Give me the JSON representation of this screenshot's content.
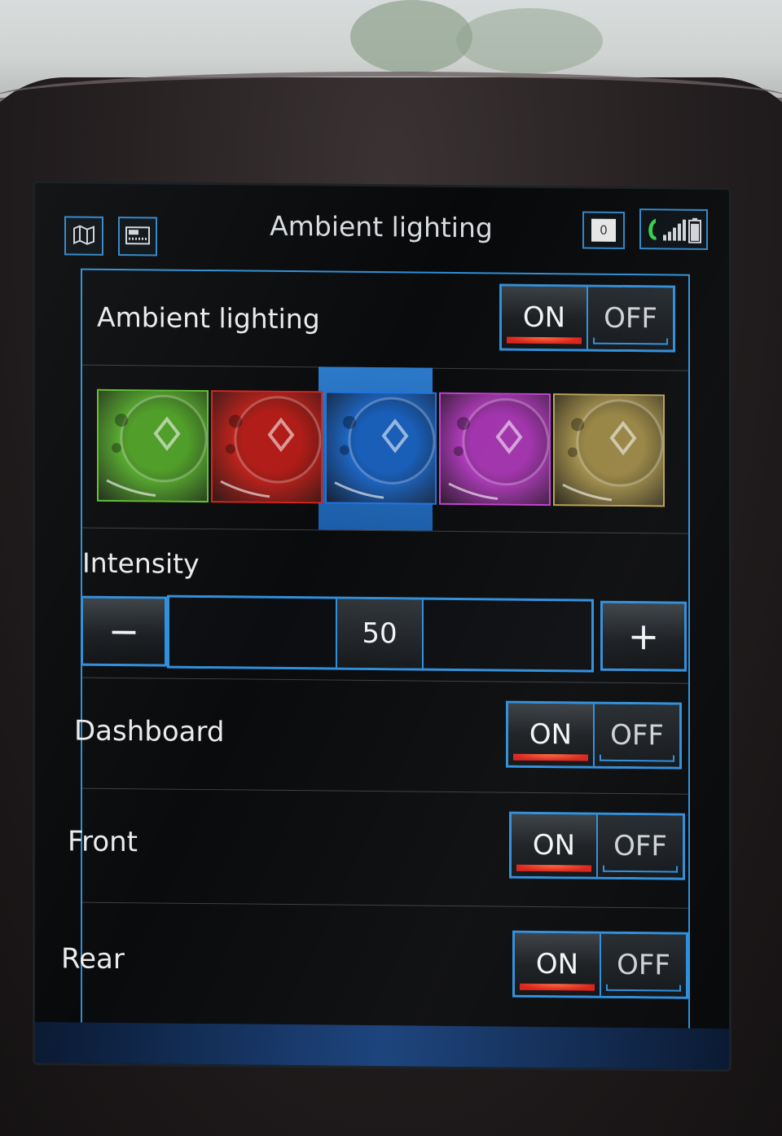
{
  "header": {
    "title": "Ambient lighting",
    "notification_count": "0"
  },
  "ambient": {
    "label": "Ambient lighting",
    "on_label": "ON",
    "off_label": "OFF",
    "selected": "ON"
  },
  "color_options": [
    {
      "name": "green",
      "color": "#5fbf2f"
    },
    {
      "name": "red",
      "color": "#d7221b"
    },
    {
      "name": "blue",
      "color": "#1f73e0"
    },
    {
      "name": "purple",
      "color": "#c53fd2"
    },
    {
      "name": "gold",
      "color": "#b9a253"
    }
  ],
  "selected_color": "blue",
  "intensity": {
    "label": "Intensity",
    "value": "50",
    "minus_label": "−",
    "plus_label": "+",
    "fraction": 0.5
  },
  "zones": [
    {
      "label": "Dashboard",
      "on_label": "ON",
      "off_label": "OFF",
      "selected": "ON"
    },
    {
      "label": "Front",
      "on_label": "ON",
      "off_label": "OFF",
      "selected": "ON"
    },
    {
      "label": "Rear",
      "on_label": "ON",
      "off_label": "OFF",
      "selected": "ON"
    }
  ],
  "colors": {
    "accent": "#2f8fdc",
    "on_indicator": "#e3281d",
    "text": "#e9ebec",
    "call_icon": "#35d14a"
  },
  "icons": {
    "map": "map-icon",
    "radio": "radio-fm-icon",
    "notification": "notification-icon",
    "phone": "phone-icon",
    "signal": "signal-strength-icon",
    "battery": "battery-icon"
  }
}
